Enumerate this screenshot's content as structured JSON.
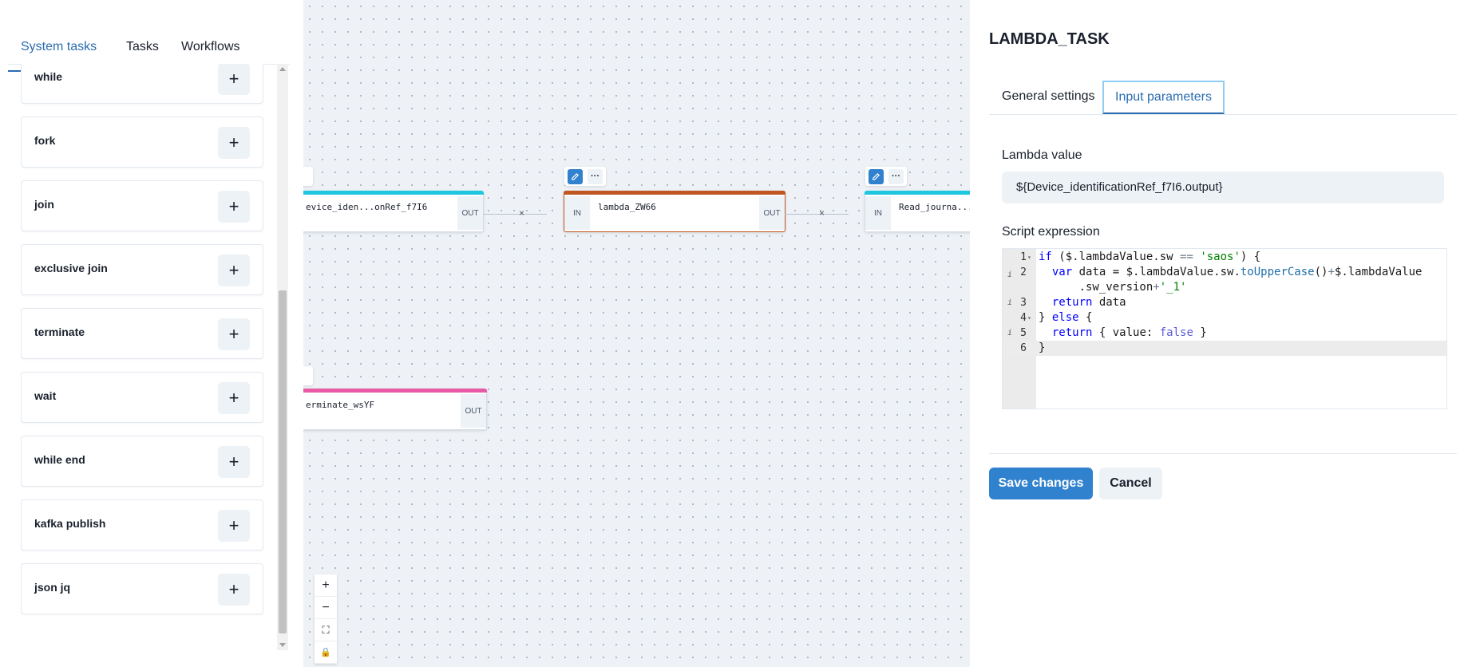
{
  "left_panel": {
    "tabs": [
      {
        "label": "System tasks",
        "active": true
      },
      {
        "label": "Tasks",
        "active": false
      },
      {
        "label": "Workflows",
        "active": false
      }
    ],
    "tasks": [
      {
        "name": "while",
        "add": "+"
      },
      {
        "name": "fork",
        "add": "+"
      },
      {
        "name": "join",
        "add": "+"
      },
      {
        "name": "exclusive join",
        "add": "+"
      },
      {
        "name": "terminate",
        "add": "+"
      },
      {
        "name": "wait",
        "add": "+"
      },
      {
        "name": "while end",
        "add": "+"
      },
      {
        "name": "kafka publish",
        "add": "+"
      },
      {
        "name": "json jq",
        "add": "+"
      }
    ]
  },
  "canvas": {
    "nodes": [
      {
        "label": "evice_iden...onRef_f7I6",
        "in": "",
        "out": "OUT",
        "color": "#1fc6e0"
      },
      {
        "label": "lambda_ZW66",
        "in": "IN",
        "out": "OUT",
        "color": "#c05621"
      },
      {
        "label": "Read_journa...",
        "in": "IN",
        "out": "",
        "color": "#1fc6e0"
      },
      {
        "label": "erminate_wsYF",
        "in": "",
        "out": "OUT",
        "color": "#e85aa5"
      }
    ],
    "edge_remove": "×",
    "toolbar": {
      "more": "···"
    },
    "zoom": {
      "in": "+",
      "out": "−",
      "fit": "⛶",
      "lock": "🔒"
    }
  },
  "right_panel": {
    "title": "LAMBDA_TASK",
    "tabs": [
      {
        "label": "General settings",
        "active": false
      },
      {
        "label": "Input parameters",
        "active": true
      }
    ],
    "lambda_value_label": "Lambda value",
    "lambda_value": "${Device_identificationRef_f7I6.output}",
    "script_label": "Script expression",
    "code_lines": [
      {
        "n": "1",
        "text": "if ($.lambdaValue.sw == 'saos') {"
      },
      {
        "n": "2",
        "text": "  var data = $.lambdaValue.sw.toUpperCase()+$.lambdaValue"
      },
      {
        "n": "",
        "text": "      .sw_version+'_1'"
      },
      {
        "n": "3",
        "text": "  return data"
      },
      {
        "n": "4",
        "text": "} else {"
      },
      {
        "n": "5",
        "text": "  return { value: false }"
      },
      {
        "n": "6",
        "text": "}"
      }
    ],
    "save_label": "Save changes",
    "cancel_label": "Cancel"
  }
}
